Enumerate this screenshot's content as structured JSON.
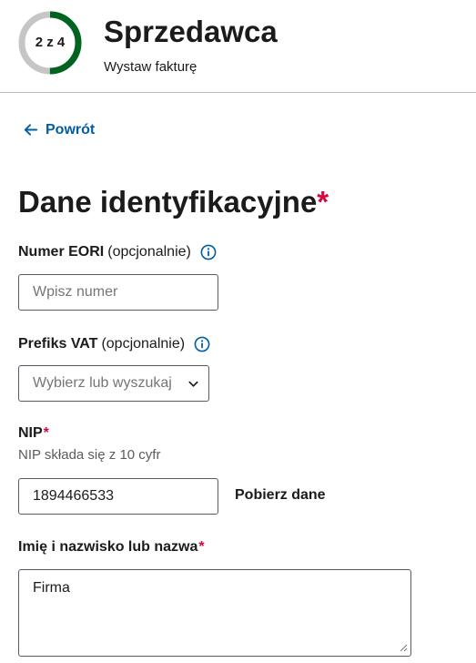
{
  "header": {
    "step_label": "2 z 4",
    "step_current": 2,
    "step_total": 4,
    "title": "Sprzedawca",
    "subtitle": "Wystaw fakturę"
  },
  "nav": {
    "back_label": "Powrót",
    "back_icon": "arrow-left-icon"
  },
  "section": {
    "title": "Dane identyfikacyjne",
    "required_mark": "*"
  },
  "fields": {
    "eori": {
      "label": "Numer EORI",
      "optional": "(opcjonalnie)",
      "placeholder": "Wpisz numer",
      "value": "",
      "icon": "info-icon"
    },
    "vat_prefix": {
      "label": "Prefiks VAT",
      "optional": "(opcjonalnie)",
      "placeholder": "Wybierz lub wyszukaj",
      "icon": "info-icon"
    },
    "nip": {
      "label": "NIP",
      "required_mark": "*",
      "hint": "NIP składa się z 10 cyfr",
      "value": "1894466533",
      "action_label": "Pobierz dane"
    },
    "name": {
      "label": "Imię i nazwisko lub nazwa",
      "required_mark": "*",
      "value": "Firma"
    }
  },
  "colors": {
    "accent": "#005ea2",
    "progress_done": "#00631f",
    "progress_track": "#c6c6c6",
    "required": "#d3093f"
  }
}
